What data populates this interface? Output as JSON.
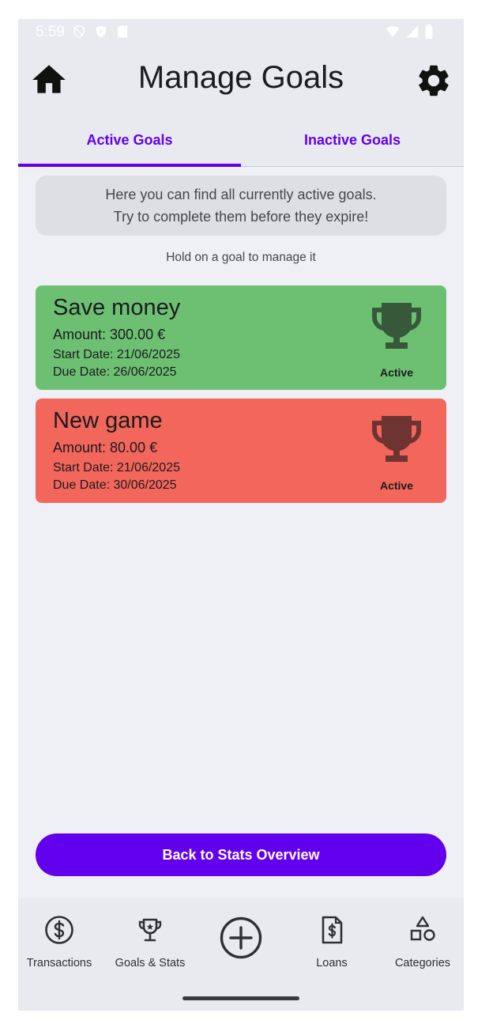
{
  "status_bar": {
    "time": "5:59"
  },
  "header": {
    "title": "Manage Goals",
    "home_icon": "home-icon",
    "settings_icon": "gear-icon"
  },
  "tabs": [
    {
      "label": "Active Goals",
      "selected": true
    },
    {
      "label": "Inactive Goals",
      "selected": false
    }
  ],
  "info": {
    "line1": "Here you can find all currently active goals.",
    "line2": "Try to complete them before they expire!"
  },
  "hint": "Hold on a goal to manage it",
  "goals": [
    {
      "name": "Save money",
      "amount": "Amount: 300.00 €",
      "start": "Start Date: 21/06/2025",
      "due": "Due Date: 26/06/2025",
      "status": "Active",
      "card_color": "#6dbf72",
      "trophy_color": "#37593a"
    },
    {
      "name": "New game",
      "amount": "Amount: 80.00 €",
      "start": "Start Date: 21/06/2025",
      "due": "Due Date: 30/06/2025",
      "status": "Active",
      "card_color": "#f2665b",
      "trophy_color": "#6e3431"
    }
  ],
  "back_button": "Back to Stats Overview",
  "bottom_nav": [
    {
      "label": "Transactions",
      "icon": "dollar-circle-icon"
    },
    {
      "label": "Goals & Stats",
      "icon": "trophy-icon"
    },
    {
      "label": "",
      "icon": "add-circle-icon"
    },
    {
      "label": "Loans",
      "icon": "invoice-icon"
    },
    {
      "label": "Categories",
      "icon": "shapes-icon"
    }
  ],
  "colors": {
    "accent": "#6200ee",
    "background": "#eff0f5",
    "bar": "#e8eaf0"
  }
}
